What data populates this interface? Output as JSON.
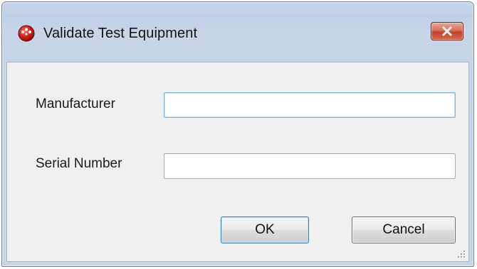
{
  "window": {
    "title": "Validate Test Equipment",
    "icon": "red-globe-icon",
    "close_icon": "close-x-icon",
    "close_button_color": "#c7452d"
  },
  "form": {
    "manufacturer": {
      "label": "Manufacturer",
      "value": ""
    },
    "serial_number": {
      "label": "Serial Number",
      "value": ""
    }
  },
  "buttons": {
    "ok_label": "OK",
    "cancel_label": "Cancel"
  },
  "colors": {
    "client_background": "#f0f0f0",
    "title_bar": "#bed0e8",
    "focus_border": "#7fb3e3"
  }
}
